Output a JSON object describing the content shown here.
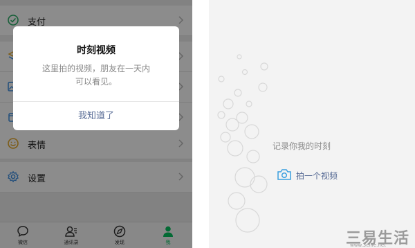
{
  "menu": {
    "items": [
      {
        "label": "支付",
        "icon": "pay-icon"
      },
      {
        "label": "",
        "icon": "favorites-icon"
      },
      {
        "label": "",
        "icon": "album-icon"
      },
      {
        "label": "",
        "icon": "cards-icon"
      },
      {
        "label": "表情",
        "icon": "sticker-icon"
      },
      {
        "label": "设置",
        "icon": "gear-icon"
      }
    ]
  },
  "tabbar": {
    "tabs": [
      {
        "label": "微信",
        "icon": "chat-icon",
        "active": false
      },
      {
        "label": "通讯录",
        "icon": "contacts-icon",
        "active": false
      },
      {
        "label": "发现",
        "icon": "compass-icon",
        "active": false
      },
      {
        "label": "我",
        "icon": "me-icon",
        "active": true
      }
    ]
  },
  "dialog": {
    "title": "时刻视频",
    "message_line1": "这里拍的视频，朋友在一天内",
    "message_line2": "可以看见。",
    "button": "我知道了"
  },
  "moments_video": {
    "caption": "记录你我的时刻",
    "shoot_label": "拍一个视频"
  },
  "watermark": {
    "text": "三易生活",
    "url": "www.3elife.net"
  },
  "colors": {
    "accent_green": "#07c160",
    "link_blue": "#576b95",
    "pay_green": "#2aae67"
  }
}
